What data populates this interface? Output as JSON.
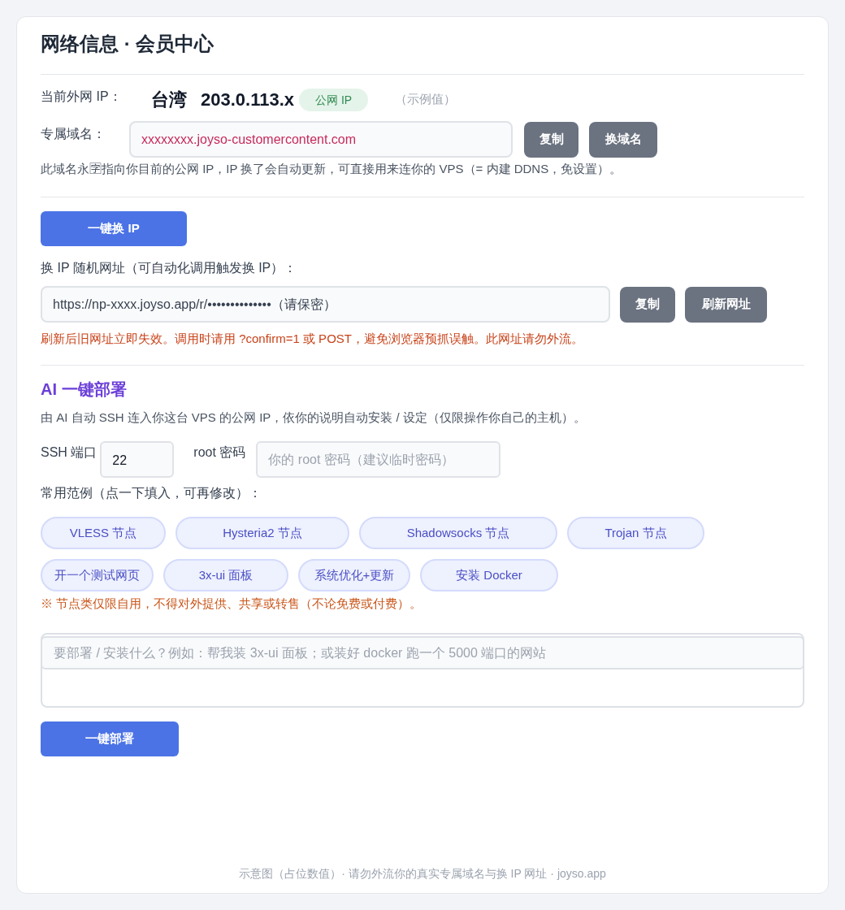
{
  "title": "网络信息 · 会员中心",
  "ip_row": {
    "label": "当前外网 IP：",
    "region": "台湾",
    "ip": "203.0.113.x",
    "badge": "公网 IP",
    "note": "（示例值）"
  },
  "domain": {
    "label": "专属域名：",
    "value": "xxxxxxxx.joyso-customercontent.com",
    "buttons": [
      "复制",
      "换域名"
    ],
    "hint": "此域名永🈑指向你目前的公网 IP，IP 换了会自动更新，可直接用来连你的 VPS（= 内建 DDNS，免设置）。"
  },
  "change_ip": {
    "button": "一键换 IP",
    "label": "换 IP 随机网址（可自动化调用触发换 IP）：",
    "url": "https://np-xxxx.joyso.app/r/••••••••••••••（请保密）",
    "buttons": [
      "复制",
      "刷新网址"
    ],
    "warning": "刷新后旧网址立即失效。调用时请用 ?confirm=1 或 POST，避免浏览器预抓误触。此网址请勿外流。"
  },
  "ai_deploy": {
    "heading": "AI 一键部署",
    "description": "由 AI 自动 SSH 连入你这台 VPS 的公网 IP，依你的说明自动安装 / 设定（仅限操作你自己的主机）。",
    "port_label": "SSH 端口",
    "port_value": "22",
    "password_label": "root 密码",
    "password_placeholder": "你的 root 密码（建议临时密码）",
    "examples_label": "常用范例（点一下填入，可再修改）：",
    "examples": [
      "VLESS 节点",
      "Hysteria2 节点",
      "Shadowsocks 节点",
      "Trojan 节点",
      "开一个测试网页",
      "3x-ui 面板",
      "系统优化+更新",
      "安装 Docker"
    ],
    "notice": "※ 节点类仅限自用，不得对外提供、共享或转售（不论免费或付费）。",
    "prompt_placeholder": "要部署 / 安装什么？例如：帮我装 3x-ui 面板；或装好 docker 跑一个 5000 端口的网站",
    "button": "一键部署"
  },
  "footer": "示意图（占位数值）· 请勿外流你的真实专属域名与换 IP 网址 · joyso.app"
}
